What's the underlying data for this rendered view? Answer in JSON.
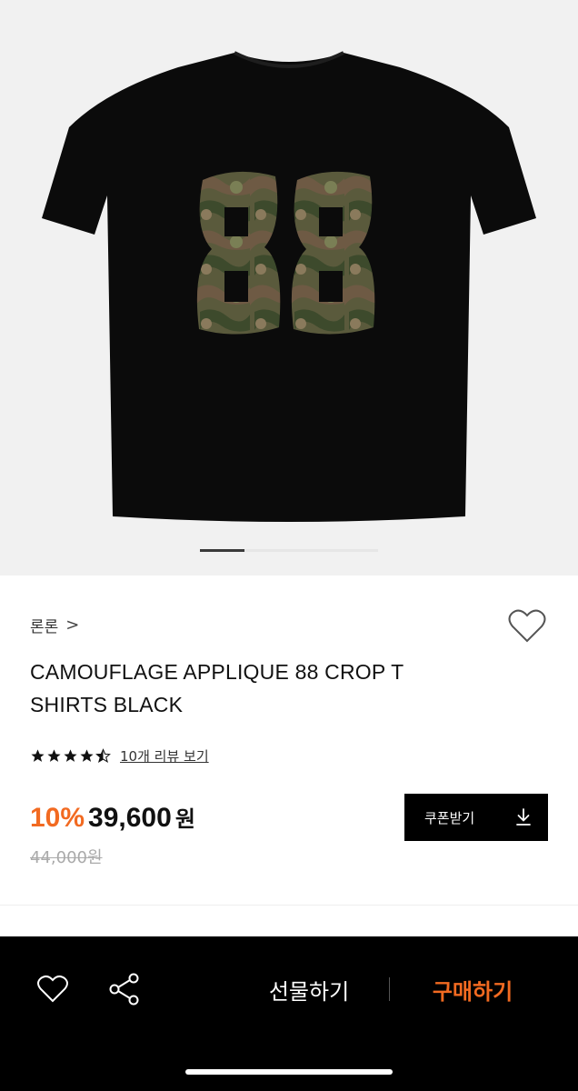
{
  "gallery": {
    "image_name": "black crop t-shirt with camouflage 88 applique",
    "page_count": 4,
    "active_index": 0
  },
  "product": {
    "brand_label": "론론",
    "brand_chevron": ">",
    "title": "CAMOUFLAGE APPLIQUE 88 CROP T SHIRTS BLACK",
    "rating": 4.5,
    "review_link": "10개 리뷰 보기",
    "discount": "10%",
    "sale_price": "39,600",
    "sale_unit": "원",
    "original_price": "44,000원",
    "coupon_label": "쿠폰받기",
    "coupon_icon": "download-icon",
    "wishlist_icon": "heart-outline-icon"
  },
  "bottom_bar": {
    "wish_icon": "heart-outline-icon",
    "share_icon": "share-icon",
    "gift_label": "선물하기",
    "buy_label": "구매하기",
    "accent": "#f26a21"
  }
}
